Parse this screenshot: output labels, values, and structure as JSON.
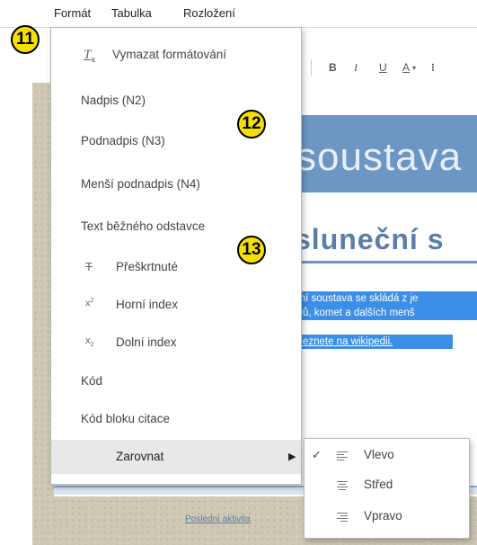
{
  "menubar": {
    "items": [
      "Formát",
      "Tabulka",
      "Rozložení"
    ]
  },
  "badges": [
    "11",
    "12",
    "13"
  ],
  "toolbar": {
    "bold": "B",
    "italic": "I",
    "underline": "U",
    "font_color": "A",
    "more": "⁝"
  },
  "dropdown": {
    "clear_formatting": "Vymazat formátování",
    "heading": "Nadpis (N2)",
    "subheading": "Podnadpis (N3)",
    "minor_subheading": "Menší podnadpis (N4)",
    "normal_text": "Text běžného odstavce",
    "strikethrough": "Přeškrtnuté",
    "superscript": "Horní index",
    "subscript": "Dolní index",
    "code": "Kód",
    "code_block": "Kód bloku citace",
    "align": "Zarovnat"
  },
  "submenu": {
    "left": "Vlevo",
    "center": "Střed",
    "right": "Vpravo",
    "checked": "left"
  },
  "document": {
    "title": "soustava",
    "subtitle": "sluneční s",
    "line1": "ční soustava se skládá z je",
    "line2": "idů, komet a dalších menš",
    "line3": "aleznete na wikipedii.",
    "footer": "Poslední aktivita"
  },
  "colors": {
    "accent": "#6c96c4",
    "selection": "#3b8fe6",
    "badge": "#f6e000"
  }
}
